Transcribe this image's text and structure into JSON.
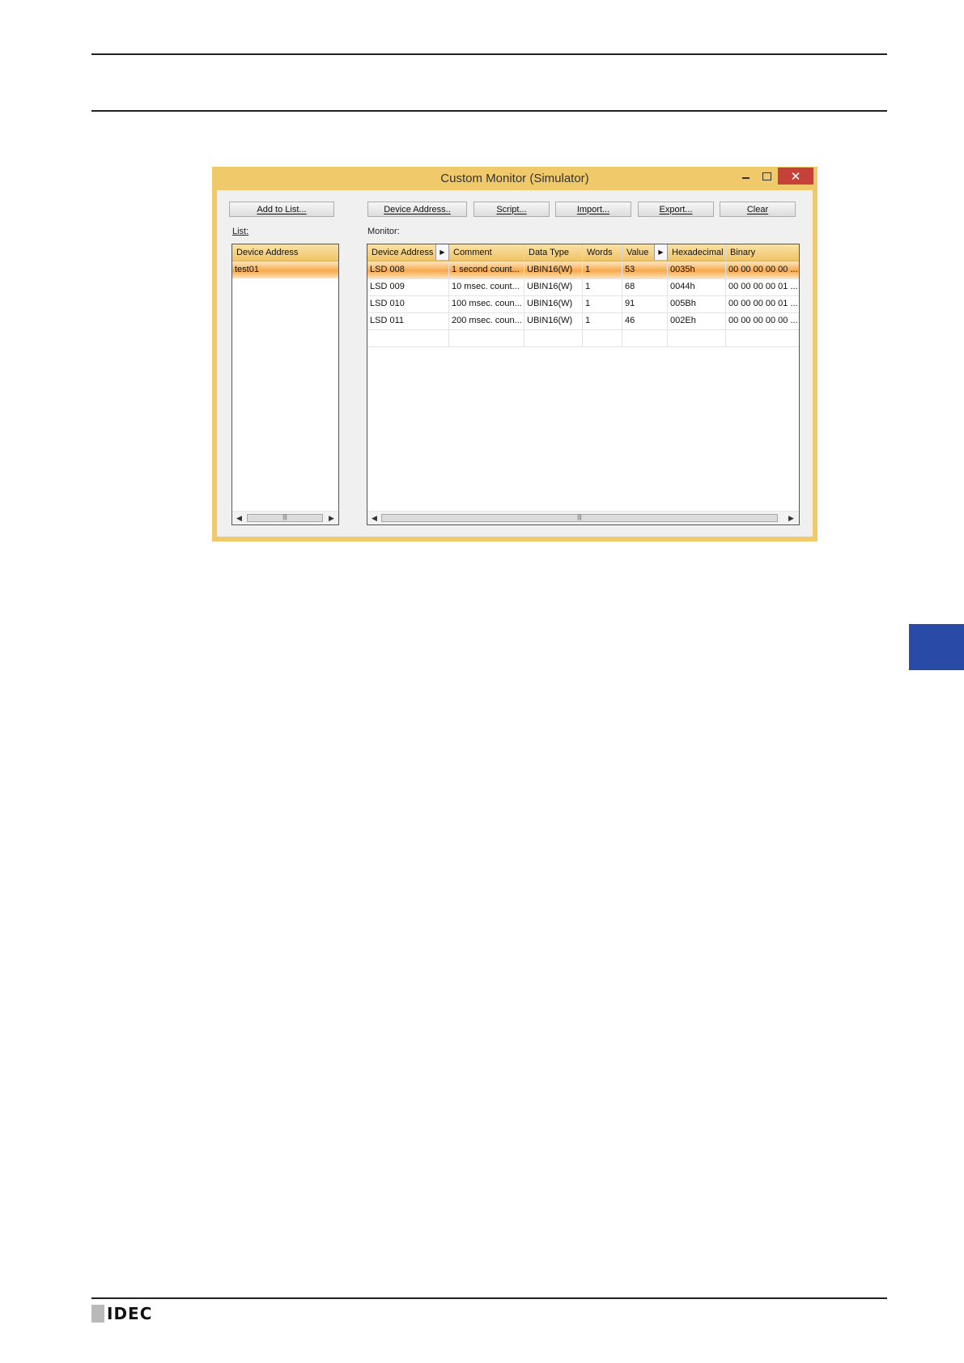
{
  "window": {
    "title": "Custom Monitor (Simulator)",
    "close_glyph": "✕"
  },
  "buttons": {
    "add_to_list": "Add to List...",
    "device_address": "Device Address..",
    "script": "Script...",
    "import": "Import...",
    "export": "Export...",
    "clear": "Clear"
  },
  "list_panel": {
    "label": "List:",
    "header": "Device Address",
    "items": [
      "test01"
    ],
    "selected_index": 0
  },
  "monitor_panel": {
    "label": "Monitor:",
    "columns": [
      "Device Address",
      "Comment",
      "Data Type",
      "Words",
      "Value",
      "Hexadecimal",
      "Binary"
    ],
    "rows": [
      [
        "LSD 008",
        "1 second count...",
        "UBIN16(W)",
        "1",
        "53",
        "0035h",
        "00 00 00 00 00 ..."
      ],
      [
        "LSD 009",
        "10 msec. count...",
        "UBIN16(W)",
        "1",
        "68",
        "0044h",
        "00 00 00 00 01 ..."
      ],
      [
        "LSD 010",
        "100 msec. coun...",
        "UBIN16(W)",
        "1",
        "91",
        "005Bh",
        "00 00 00 00 01 ..."
      ],
      [
        "LSD 011",
        "200 msec. coun...",
        "UBIN16(W)",
        "1",
        "46",
        "002Eh",
        "00 00 00 00 00 ..."
      ],
      [
        "",
        "",
        "",
        "",
        "",
        "",
        ""
      ]
    ],
    "selected_index": 0
  },
  "footer": {
    "brand": "IDEC"
  },
  "colors": {
    "window_frame": "#f0c96a",
    "close_button": "#c7413b",
    "selection": "#f6a94d",
    "side_tab": "#2a4aa8"
  },
  "icons": [
    "minimize-icon",
    "maximize-icon",
    "close-icon",
    "scroll-left-icon",
    "scroll-right-icon",
    "sort-arrow-icon"
  ]
}
